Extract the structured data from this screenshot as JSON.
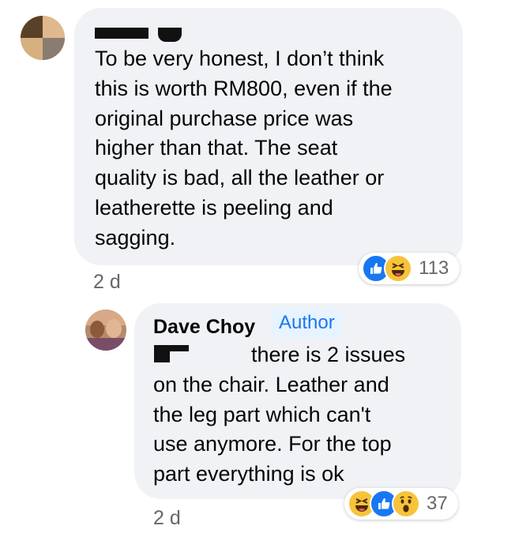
{
  "comment": {
    "lines": [
      "To be very honest, I don’t think",
      "this is worth RM800, even if the",
      "original purchase price was",
      "higher than that. The seat",
      "quality is bad, all the leather or",
      "leatherette is peeling and",
      "sagging."
    ],
    "time": "2 d",
    "reaction_count": "113",
    "reactions": [
      "like-icon",
      "haha-icon"
    ]
  },
  "reply": {
    "author": "Dave Choy",
    "badge": "Author",
    "lines": [
      "there is 2 issues",
      "on the chair. Leather and",
      "the leg part which can't",
      "use anymore. For the top",
      "part everything is ok"
    ],
    "time": "2 d",
    "reaction_count": "37",
    "reactions": [
      "haha-icon",
      "like-icon",
      "wow-icon"
    ]
  },
  "colors": {
    "bubble": "#f0f2f5",
    "like": "#1877f2",
    "emoji_yellow": "#f7c33b",
    "meta_text": "#65676b",
    "badge_bg": "#e7f3ff"
  }
}
